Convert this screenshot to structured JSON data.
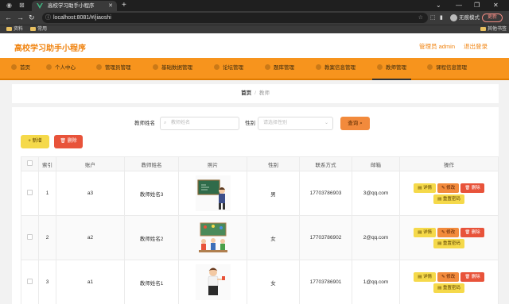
{
  "browser": {
    "tab_title": "高校学习助手小程序",
    "url": "localhost:8081/#/jiaoshi",
    "incognito_label": "无痕模式",
    "update_label": "更新",
    "bookmarks": [
      "资料",
      "常用"
    ],
    "other_bookmarks": "其他书签"
  },
  "app": {
    "title": "高校学习助手小程序",
    "user_label": "管理员 admin",
    "logout_label": "退出登录",
    "accent_color": "#f7941d"
  },
  "menu": {
    "items": [
      {
        "label": "首页"
      },
      {
        "label": "个人中心"
      },
      {
        "label": "管理员管理"
      },
      {
        "label": "基础数据管理"
      },
      {
        "label": "论坛管理"
      },
      {
        "label": "题库管理"
      },
      {
        "label": "教案信息管理"
      },
      {
        "label": "教师管理"
      },
      {
        "label": "课程信息管理"
      }
    ],
    "active": "教师管理"
  },
  "breadcrumb": {
    "home": "首页",
    "sep": "/",
    "current": "教师"
  },
  "search": {
    "name_label": "教师姓名",
    "name_placeholder": "教师姓名",
    "gender_label": "性别",
    "gender_placeholder": "请选择性别",
    "query_label": "查询"
  },
  "toolbar": {
    "add_label": "新增",
    "delete_label": "删除"
  },
  "table": {
    "headers": [
      "",
      "索引",
      "账户",
      "教师姓名",
      "照片",
      "性别",
      "联系方式",
      "邮箱",
      "操作"
    ],
    "rows": [
      {
        "index": "1",
        "account": "a3",
        "name": "教师姓名3",
        "gender": "男",
        "phone": "17703786903",
        "email": "3@qq.com"
      },
      {
        "index": "2",
        "account": "a2",
        "name": "教师姓名2",
        "gender": "女",
        "phone": "17703786902",
        "email": "2@qq.com"
      },
      {
        "index": "3",
        "account": "a1",
        "name": "教师姓名1",
        "gender": "女",
        "phone": "17703786901",
        "email": "1@qq.com"
      }
    ],
    "row_actions": {
      "detail": "详情",
      "edit": "修改",
      "delete": "删除",
      "reset": "重置密码"
    }
  }
}
